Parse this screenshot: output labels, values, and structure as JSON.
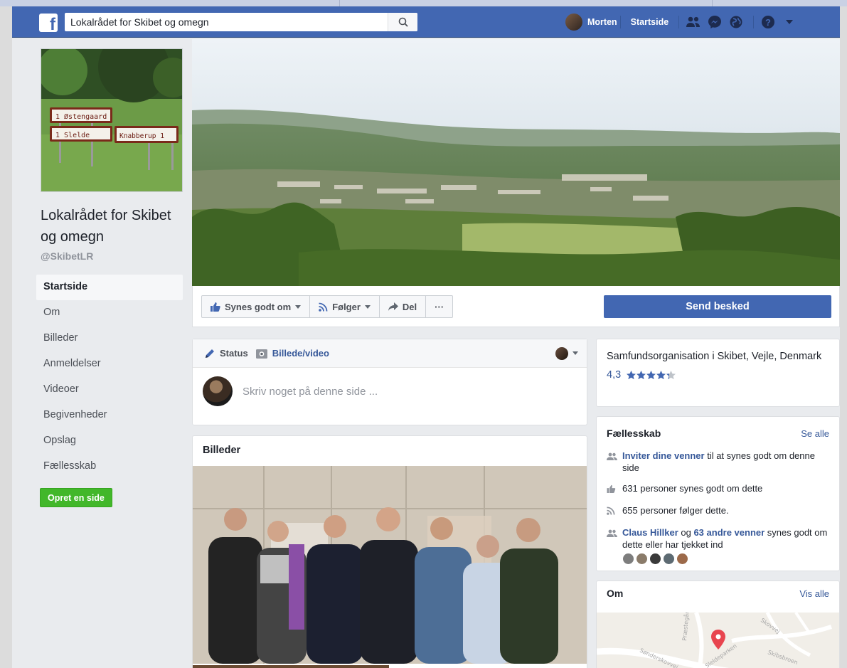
{
  "topbar": {
    "search_value": "Lokalrådet for Skibet og omegn",
    "user_name": "Morten",
    "home_label": "Startside"
  },
  "page": {
    "name": "Lokalrådet for Skibet og omegn",
    "handle": "@SkibetLR",
    "sign_lines": [
      "1 Østengaard",
      "1 Slelde",
      "Knabberup 1"
    ]
  },
  "side_nav": {
    "items": [
      "Startside",
      "Om",
      "Billeder",
      "Anmeldelser",
      "Videoer",
      "Begivenheder",
      "Opslag",
      "Fællesskab"
    ],
    "create_label": "Opret en side"
  },
  "actions": {
    "like_label": "Synes godt om",
    "follow_label": "Følger",
    "share_label": "Del",
    "more_label": "···",
    "message_label": "Send besked"
  },
  "composer": {
    "status_label": "Status",
    "photo_label": "Billede/video",
    "placeholder": "Skriv noget på denne side ..."
  },
  "photos": {
    "title": "Billeder"
  },
  "info": {
    "category": "Samfundsorganisation i Skibet, Vejle, Denmark",
    "rating": "4,3",
    "stars": 4.3
  },
  "community": {
    "title": "Fællesskab",
    "see_all": "Se alle",
    "invite_link": "Inviter dine venner",
    "invite_rest": " til at synes godt om denne side",
    "likes_text": "631 personer synes godt om dette",
    "follows_text": "655 personer følger dette.",
    "friend_name": "Claus Hillker",
    "friend_og": " og ",
    "friends_count": "63 andre venner",
    "friends_rest": " synes godt om dette eller har tjekket ind"
  },
  "about": {
    "title": "Om",
    "see_all": "Vis alle",
    "map_labels": [
      "Sønderskovvej",
      "Præstegård",
      "Sleldeparken",
      "Skibsbroen",
      "Skovvej"
    ]
  },
  "colors": {
    "brand_blue": "#4267b2",
    "link_blue": "#365899",
    "create_green": "#42b72a"
  }
}
